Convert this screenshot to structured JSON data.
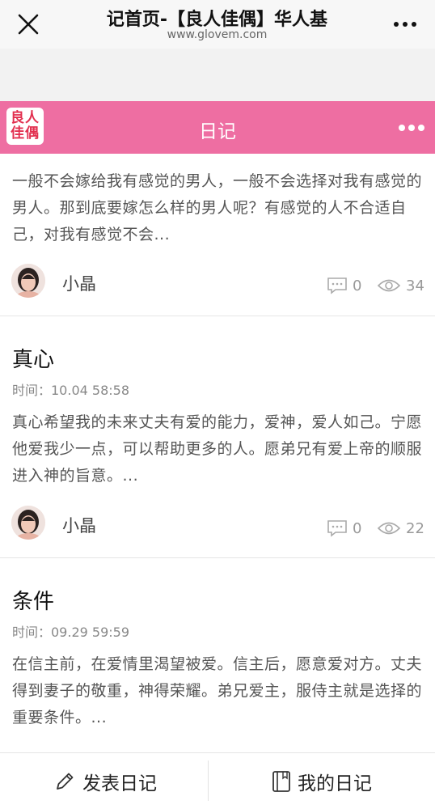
{
  "browser": {
    "title": "记首页-【良人佳偶】华人基",
    "url": "www.glovem.com"
  },
  "header": {
    "logo_text": "良人佳偶",
    "title": "日记"
  },
  "entries": [
    {
      "excerpt": "一般不会嫁给我有感觉的男人，一般不会选择对我有感觉的男人。那到底要嫁怎么样的男人呢？有感觉的人不合适自己，对我有感觉不会...",
      "author": "小晶",
      "comments": "0",
      "views": "34"
    },
    {
      "title": "真心",
      "time": "时间：10.04 58:58",
      "excerpt": "真心希望我的未来丈夫有爱的能力，爱神，爱人如己。宁愿他爱我少一点，可以帮助更多的人。愿弟兄有爱上帝的顺服进入神的旨意。...",
      "author": "小晶",
      "comments": "0",
      "views": "22"
    },
    {
      "title": "条件",
      "time": "时间：09.29 59:59",
      "excerpt": "在信主前，在爱情里渴望被爱。信主后，愿意爱对方。丈夫得到妻子的敬重，神得荣耀。弟兄爱主，服侍主就是选择的重要条件。..."
    }
  ],
  "bottom": {
    "post_label": "发表日记",
    "my_label": "我的日记"
  }
}
